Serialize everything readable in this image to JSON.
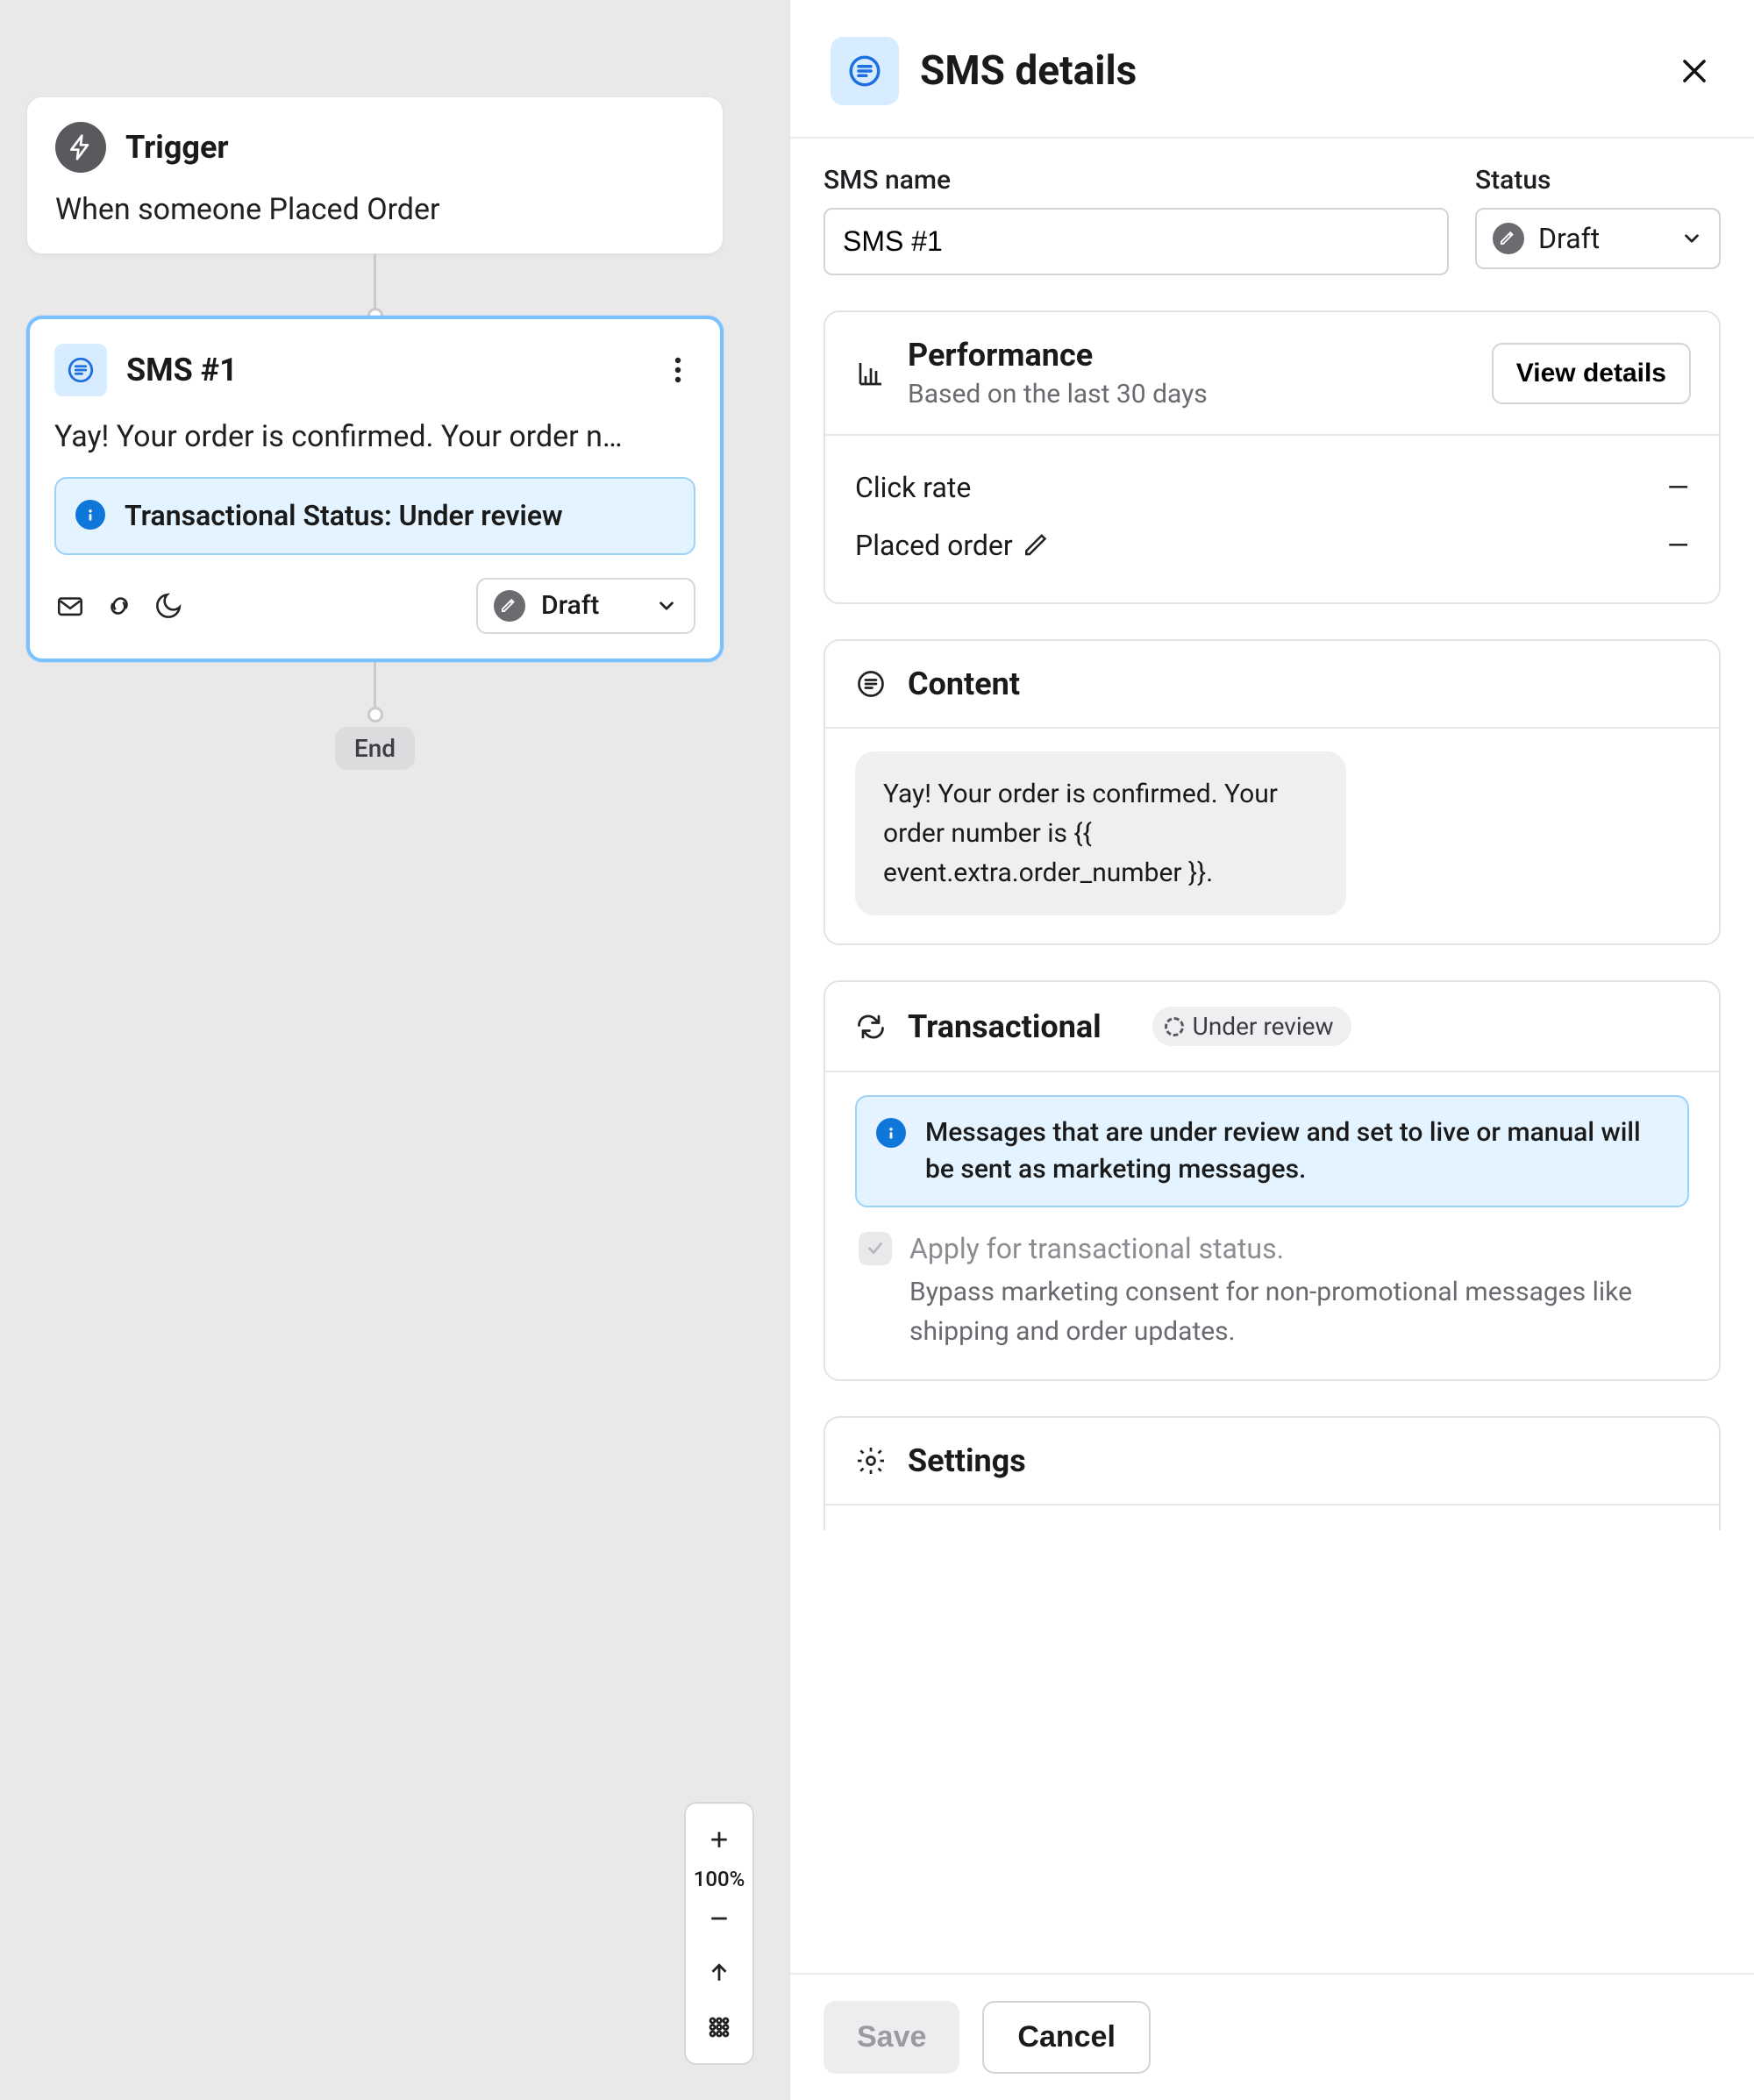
{
  "canvas": {
    "trigger": {
      "title": "Trigger",
      "desc": "When someone Placed Order"
    },
    "sms": {
      "title": "SMS #1",
      "preview": "Yay! Your order is confirmed. Your order n…",
      "banner": "Transactional Status: Under review",
      "status_label": "Draft"
    },
    "end": "End",
    "zoom": "100%"
  },
  "panel": {
    "title": "SMS details",
    "fields": {
      "name_label": "SMS name",
      "name_value": "SMS #1",
      "status_label": "Status",
      "status_value": "Draft"
    },
    "performance": {
      "title": "Performance",
      "sub": "Based on the last 30 days",
      "view": "View details",
      "metric1_label": "Click rate",
      "metric1_value": "—",
      "metric2_label": "Placed order",
      "metric2_value": "—"
    },
    "content": {
      "title": "Content",
      "body": "Yay! Your order is confirmed. Your order number is {{ event.extra.order_number }}."
    },
    "transactional": {
      "title": "Transactional",
      "pill": "Under review",
      "notice": "Messages that are under review and set to live or manual will be sent as marketing messages.",
      "apply_label": "Apply for transactional status.",
      "apply_desc": "Bypass marketing consent for non-promotional messages like shipping and order updates."
    },
    "settings": {
      "title": "Settings"
    },
    "footer": {
      "save": "Save",
      "cancel": "Cancel"
    }
  }
}
